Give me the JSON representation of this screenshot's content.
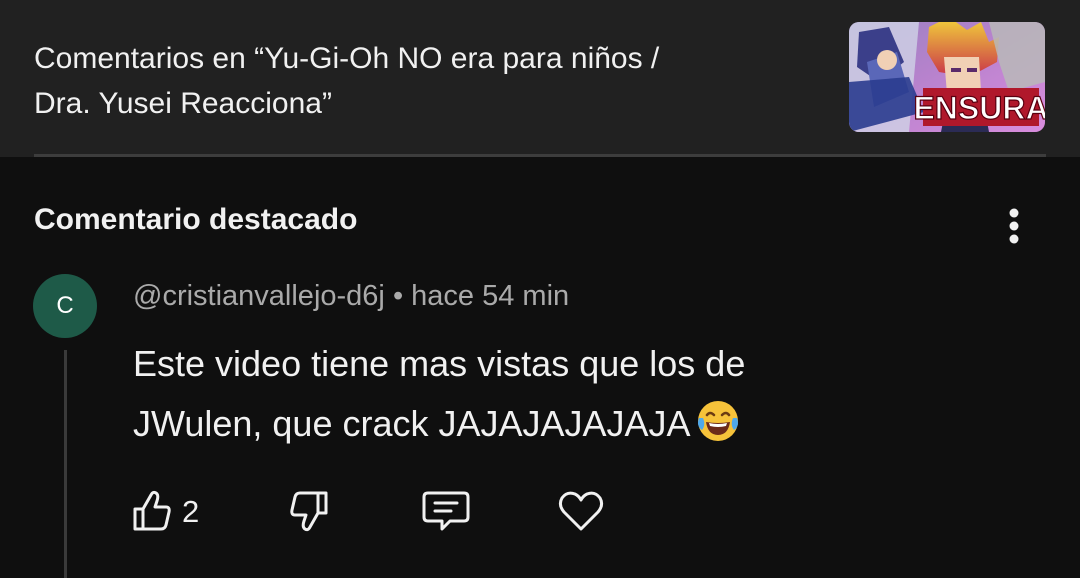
{
  "header": {
    "title_line1": "Comentarios en “Yu-Gi-Oh NO era para niños /",
    "title_line2": "Dra. Yusei Reacciona”",
    "thumbnail_text": "ENSURA"
  },
  "section": {
    "title": "Comentario destacado"
  },
  "comment": {
    "avatar_letter": "C",
    "author": "@cristianvallejo-d6j",
    "separator": "•",
    "time": "hace 54 min",
    "text_line1": "Este video tiene mas vistas que los de",
    "text_line2": "JWulen, que crack JAJAJAJAJAJA",
    "emoji": "laughing-tears-emoji",
    "like_count": "2",
    "avatar_color": "#1e5a48"
  },
  "colors": {
    "background": "#0f0f0f",
    "header_bg": "#212121",
    "primary_text": "#f1f1f1",
    "secondary_text": "#aaaaaa"
  }
}
